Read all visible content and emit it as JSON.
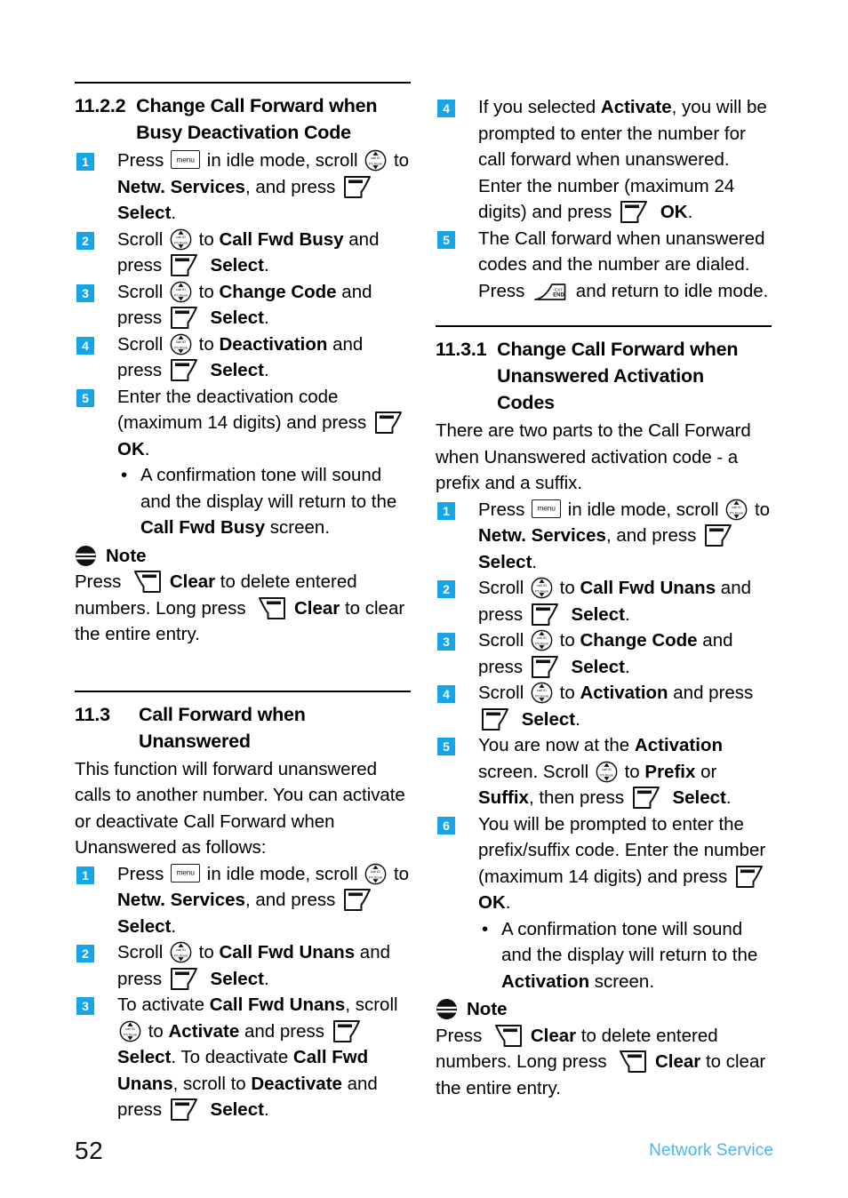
{
  "page": {
    "number": "52",
    "footer_label": "Network Service",
    "accent_marker": "#17a5e8",
    "accent_footer": "#49b6ef"
  },
  "icons": {
    "menu_label": "menu",
    "scroll_top_label": "call ID",
    "scroll_bottom_label": "Ph.Book",
    "end_top_label": "EXT",
    "end_bottom_label": "END"
  },
  "left": {
    "section_1122": {
      "number": "11.2.2",
      "title_line1": "Change Call Forward when",
      "title_line2": "Busy Deactivation Code",
      "steps": [
        {
          "n": "1",
          "p1": "Press ",
          "i1": "menu",
          "p2": " in idle mode, scroll ",
          "i2": "scroll",
          "p3": " to ",
          "b1": "Netw. Services",
          "p4": ", and press ",
          "i3": "softkey",
          "p5": " ",
          "b2": "Select",
          "p6": "."
        },
        {
          "n": "2",
          "p1": "Scroll ",
          "i1": "scroll",
          "p2": " to ",
          "b1": "Call Fwd Busy",
          "p3": " and press ",
          "i2": "softkey",
          "p4": " ",
          "b2": "Select",
          "p5": "."
        },
        {
          "n": "3",
          "p1": "Scroll ",
          "i1": "scroll",
          "p2": " to ",
          "b1": "Change Code",
          "p3": " and press ",
          "i2": "softkey",
          "p4": " ",
          "b2": "Select",
          "p5": "."
        },
        {
          "n": "4",
          "p1": "Scroll ",
          "i1": "scroll",
          "p2": " to ",
          "b1": "Deactivation",
          "p3": " and press ",
          "i2": "softkey",
          "p4": " ",
          "b2": "Select",
          "p5": "."
        },
        {
          "n": "5",
          "p1": "Enter the deactivation code (maximum 14 digits) and press ",
          "i1": "softkey",
          "p2": " ",
          "b1": "OK",
          "p3": "."
        }
      ],
      "bullet": {
        "p1": "A confirmation tone will sound and the display will return to the ",
        "b1": "Call Fwd Busy",
        "p2": " screen."
      },
      "note": {
        "title": "Note",
        "p1": "Press ",
        "i1": "clearkey",
        "p2": " ",
        "b1": "Clear",
        "p3": " to delete entered numbers. Long press ",
        "i2": "clearkey",
        "p4": " ",
        "b2": "Clear",
        "p5": " to clear the entire entry."
      }
    },
    "section_113": {
      "number": "11.3",
      "title_line1": "Call Forward when",
      "title_line2": "Unanswered",
      "intro": "This function will forward unanswered calls to another number. You can activate or deactivate Call Forward when Unanswered as follows:",
      "steps": [
        {
          "n": "1",
          "p1": "Press ",
          "i1": "menu",
          "p2": " in idle mode, scroll ",
          "i2": "scroll",
          "p3": " to ",
          "b1": "Netw. Services",
          "p4": ", and press ",
          "i3": "softkey",
          "p5": " ",
          "b2": "Select",
          "p6": "."
        },
        {
          "n": "2",
          "p1": "Scroll ",
          "i1": "scroll",
          "p2": " to ",
          "b1": "Call Fwd Unans",
          "p3": " and press ",
          "i2": "softkey",
          "p4": " ",
          "b2": "Select",
          "p5": "."
        },
        {
          "n": "3",
          "p1": "To activate ",
          "b1": "Call Fwd Unans",
          "p2": ", scroll ",
          "i1": "scroll",
          "p3": " to ",
          "b2": "Activate",
          "p4": " and press ",
          "i2": "softkey",
          "p5": " ",
          "b3": "Select",
          "p6": ". To deactivate ",
          "b4": "Call Fwd Unans",
          "p7": ", scroll to ",
          "b5": "Deactivate",
          "p8": " and press ",
          "i3": "softkey",
          "p9": " ",
          "b6": "Select",
          "p10": "."
        }
      ]
    }
  },
  "right": {
    "continued_steps": [
      {
        "n": "4",
        "p1": "If you selected ",
        "b1": "Activate",
        "p2": ", you will be prompted to enter the number for call forward when unanswered. Enter the number (maximum 24 digits) and press ",
        "i1": "softkey",
        "p3": " ",
        "b2": "OK",
        "p4": "."
      },
      {
        "n": "5",
        "p1": "The Call forward when unanswered codes and the number are dialed. Press ",
        "i1": "endkey",
        "p2": " and return to idle mode."
      }
    ],
    "section_1131": {
      "number": "11.3.1",
      "title_line1": "Change Call Forward when",
      "title_line2": "Unanswered Activation",
      "title_line3": "Codes",
      "intro": "There are two parts to the Call Forward when Unanswered activation code - a prefix and a suffix.",
      "steps": [
        {
          "n": "1",
          "p1": "Press ",
          "i1": "menu",
          "p2": " in idle mode, scroll ",
          "i2": "scroll",
          "p3": " to ",
          "b1": "Netw. Services",
          "p4": ", and press ",
          "i3": "softkey",
          "p5": " ",
          "b2": "Select",
          "p6": "."
        },
        {
          "n": "2",
          "p1": "Scroll ",
          "i1": "scroll",
          "p2": " to ",
          "b1": "Call Fwd Unans",
          "p3": " and press ",
          "i2": "softkey",
          "p4": " ",
          "b2": "Select",
          "p5": "."
        },
        {
          "n": "3",
          "p1": "Scroll ",
          "i1": "scroll",
          "p2": " to ",
          "b1": "Change Code",
          "p3": " and press ",
          "i2": "softkey",
          "p4": " ",
          "b2": "Select",
          "p5": "."
        },
        {
          "n": "4",
          "p1": "Scroll ",
          "i1": "scroll",
          "p2": " to ",
          "b1": "Activation",
          "p3": " and press ",
          "i2": "softkey",
          "p4": " ",
          "b2": "Select",
          "p5": "."
        },
        {
          "n": "5",
          "p1": "You are now at the ",
          "b1": "Activation",
          "p2": " screen. Scroll ",
          "i1": "scroll",
          "p3": " to ",
          "b2": "Prefix",
          "p4": " or ",
          "b3": "Suffix",
          "p5": ", then press ",
          "i2": "softkey",
          "p6": " ",
          "b4": "Select",
          "p7": "."
        },
        {
          "n": "6",
          "p1": "You will be prompted to enter the prefix/suffix code. Enter the number (maximum 14 digits) and press ",
          "i1": "softkey",
          "p2": " ",
          "b1": "OK",
          "p3": "."
        }
      ],
      "bullet": {
        "p1": "A confirmation tone will sound and the display will return to the ",
        "b1": "Activation",
        "p2": " screen."
      },
      "note": {
        "title": "Note",
        "p1": "Press ",
        "i1": "clearkey",
        "p2": " ",
        "b1": "Clear",
        "p3": " to delete entered numbers. Long press ",
        "i2": "clearkey",
        "p4": " ",
        "b2": "Clear",
        "p5": " to clear the entire entry."
      }
    }
  }
}
